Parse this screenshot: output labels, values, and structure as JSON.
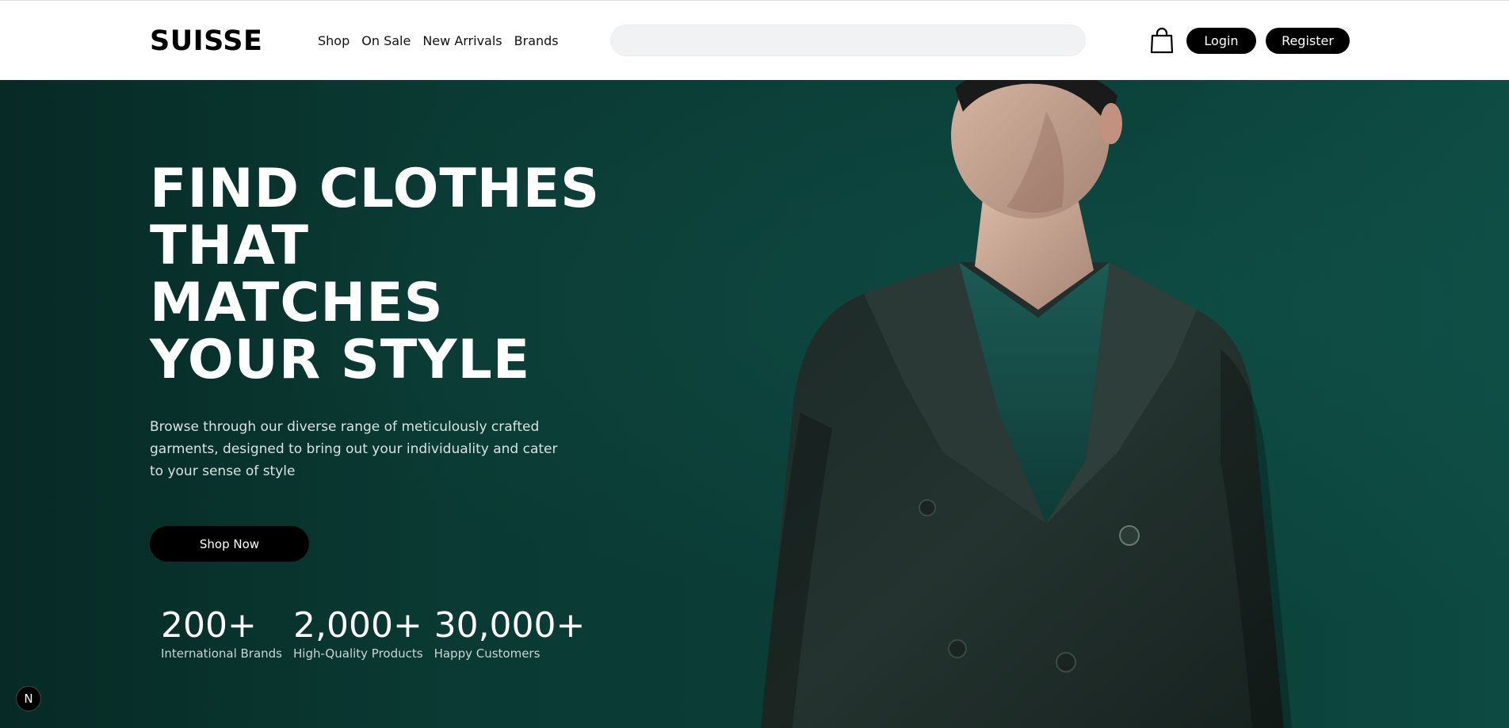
{
  "header": {
    "logo": "SUISSE",
    "nav": [
      "Shop",
      "On Sale",
      "New Arrivals",
      "Brands"
    ],
    "search_placeholder": "",
    "cart_icon": "shopping-bag-icon",
    "login_label": "Login",
    "register_label": "Register"
  },
  "hero": {
    "headline_lines": [
      "FIND CLOTHES",
      "THAT",
      "MATCHES",
      "YOUR STYLE"
    ],
    "subtext": "Browse through our diverse range of meticulously crafted garments, designed to bring out your individuality and cater to your sense of style",
    "cta_label": "Shop Now",
    "stats": [
      {
        "value": "200+",
        "label": "International Brands"
      },
      {
        "value": "2,000+",
        "label": "High-Quality Products"
      },
      {
        "value": "30,000+",
        "label": "Happy Customers"
      }
    ],
    "image": "man-in-dark-green-double-breasted-suit"
  },
  "badge": {
    "label": "N"
  },
  "colors": {
    "hero_bg": "#0b3d37",
    "button_bg": "#000000",
    "button_text": "#ffffff",
    "search_bg": "#f1f2f3"
  }
}
